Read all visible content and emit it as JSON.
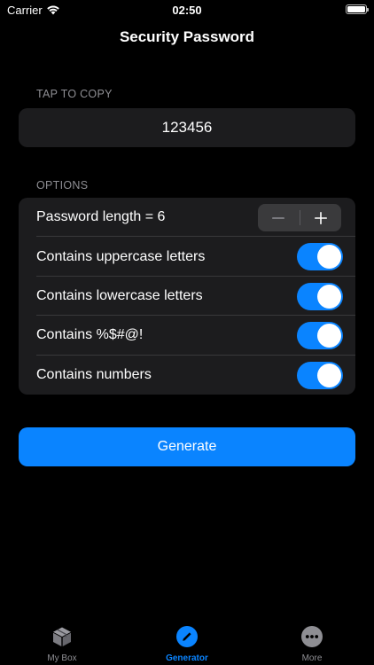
{
  "status": {
    "carrier": "Carrier",
    "time": "02:50"
  },
  "nav": {
    "title": "Security Password"
  },
  "copy_section": {
    "label": "TAP TO COPY",
    "password": "123456"
  },
  "options_section": {
    "label": "OPTIONS",
    "length_label": "Password length = 6",
    "length_value": 6,
    "toggles": [
      {
        "label": "Contains uppercase letters",
        "on": true
      },
      {
        "label": "Contains lowercase letters",
        "on": true
      },
      {
        "label": "Contains %$#@!",
        "on": true
      },
      {
        "label": "Contains numbers",
        "on": true
      }
    ]
  },
  "generate": {
    "label": "Generate"
  },
  "tabs": [
    {
      "label": "My Box",
      "icon": "box-icon",
      "active": false
    },
    {
      "label": "Generator",
      "icon": "pencil-icon",
      "active": true
    },
    {
      "label": "More",
      "icon": "more-icon",
      "active": false
    }
  ],
  "colors": {
    "accent": "#0a84ff",
    "background": "#000000",
    "card": "#1c1c1e",
    "secondary_text": "#8e8e93"
  }
}
